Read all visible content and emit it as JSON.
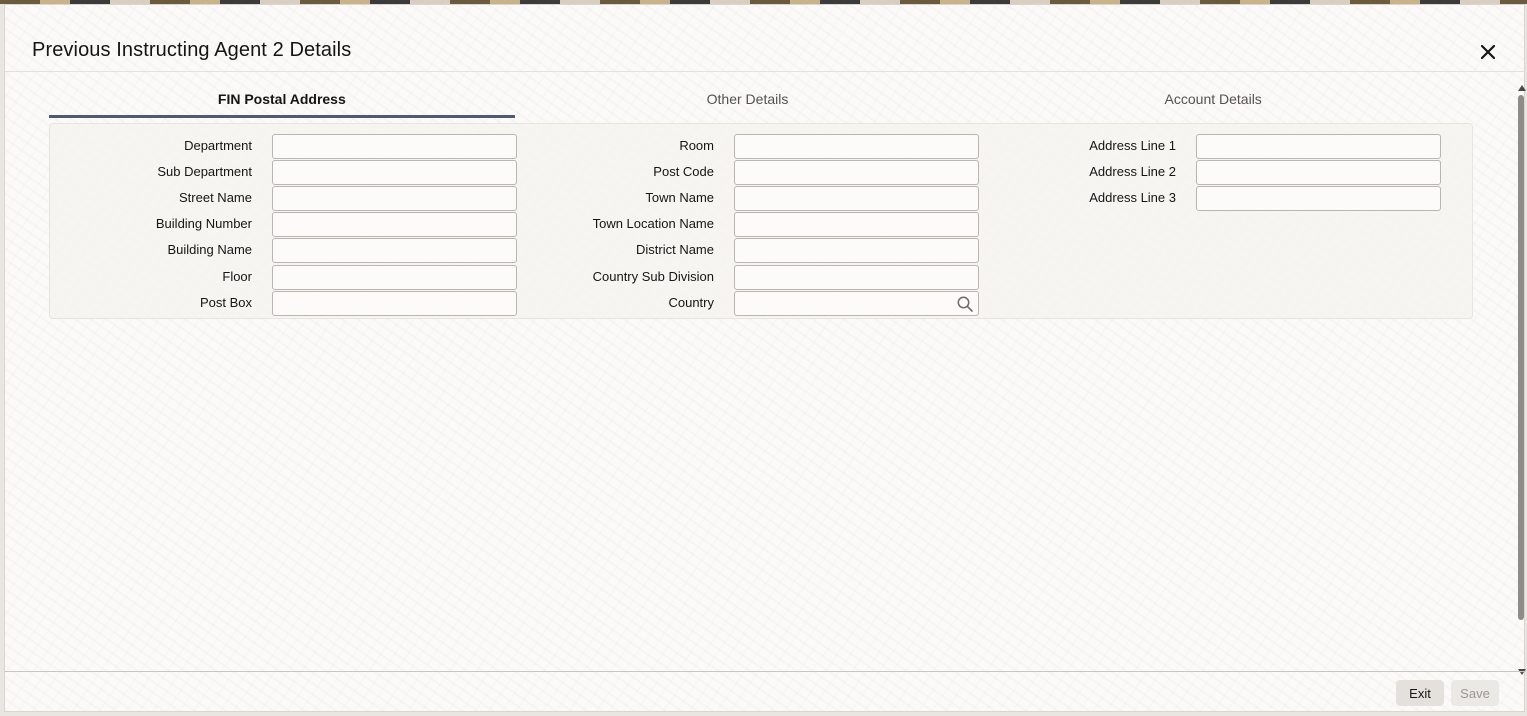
{
  "dialog": {
    "title": "Previous Instructing Agent 2 Details"
  },
  "tabs": [
    {
      "label": "FIN Postal Address",
      "active": true
    },
    {
      "label": "Other Details",
      "active": false
    },
    {
      "label": "Account Details",
      "active": false
    }
  ],
  "form": {
    "col1": [
      {
        "label": "Department",
        "value": ""
      },
      {
        "label": "Sub Department",
        "value": ""
      },
      {
        "label": "Street Name",
        "value": ""
      },
      {
        "label": "Building Number",
        "value": ""
      },
      {
        "label": "Building Name",
        "value": ""
      },
      {
        "label": "Floor",
        "value": ""
      },
      {
        "label": "Post Box",
        "value": ""
      }
    ],
    "col2": [
      {
        "label": "Room",
        "value": ""
      },
      {
        "label": "Post Code",
        "value": ""
      },
      {
        "label": "Town Name",
        "value": ""
      },
      {
        "label": "Town Location Name",
        "value": ""
      },
      {
        "label": "District Name",
        "value": ""
      },
      {
        "label": "Country Sub Division",
        "value": ""
      },
      {
        "label": "Country",
        "value": "",
        "icon": "search-icon"
      }
    ],
    "col3": [
      {
        "label": "Address Line 1",
        "value": ""
      },
      {
        "label": "Address Line 2",
        "value": ""
      },
      {
        "label": "Address Line 3",
        "value": ""
      }
    ]
  },
  "footer": {
    "exit_label": "Exit",
    "save_label": "Save"
  },
  "colors": {
    "active_tab_underline": "#4c5b72",
    "text": "#161513"
  }
}
